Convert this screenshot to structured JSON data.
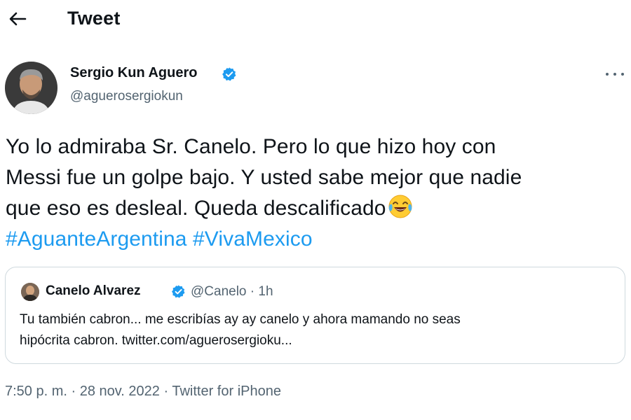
{
  "header": {
    "back_icon": "arrow-left-icon",
    "title": "Tweet"
  },
  "author": {
    "name": "Sergio Kun Aguero",
    "handle": "@aguerosergiokun",
    "verified": true,
    "verified_color": "#1d9bf0"
  },
  "tweet": {
    "lines": [
      "Yo lo admiraba Sr. Canelo. Pero lo que hizo hoy con",
      "Messi fue un golpe bajo. Y usted sabe mejor que nadie",
      "que eso es desleal. Queda descalificado"
    ],
    "emoji": "face-with-tears-of-joy",
    "hashtags": [
      "#AguanteArgentina",
      "#VivaMexico"
    ],
    "hashtag_color": "#1d9bf0"
  },
  "quoted_tweet": {
    "name": "Canelo Alvarez",
    "verified": true,
    "handle": "@Canelo",
    "separator": "·",
    "time": "1h",
    "lines": [
      "Tu también cabron... me escribías ay ay canelo y ahora mamando no seas",
      "hipócrita cabron. twitter.com/aguerosergioku..."
    ]
  },
  "footer": {
    "time": "7:50 p. m.",
    "separator": "·",
    "date": "28 nov. 2022",
    "source": "Twitter for iPhone"
  }
}
